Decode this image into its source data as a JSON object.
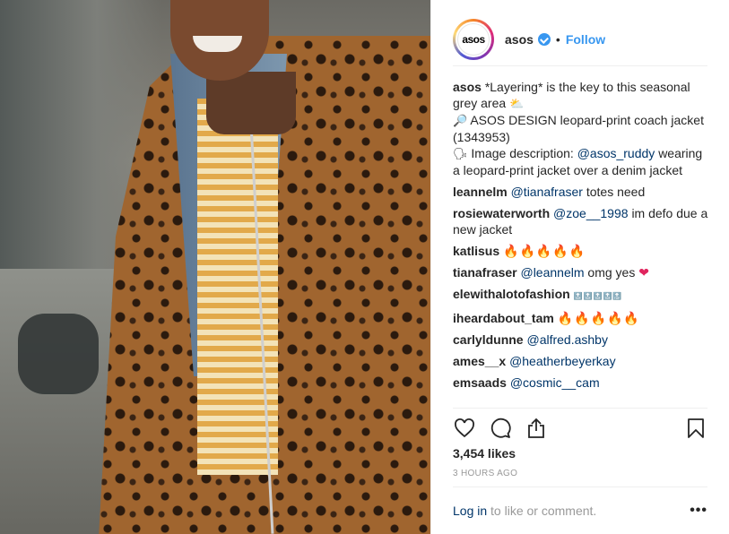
{
  "post": {
    "username": "asos",
    "follow_label": "Follow",
    "dot": "•",
    "avatar_text": "asos"
  },
  "caption": {
    "username": "asos",
    "line1": "*Layering* is the key to this seasonal grey area",
    "line1_emoji": "⛅",
    "line2_emoji": "🔎",
    "line2": "ASOS DESIGN leopard-print coach jacket (1343953)",
    "line3_emoji": "🗣",
    "line3_text": "Image description:",
    "line3_mention": "@asos_ruddy",
    "line3_rest": "wearing a leopard-print jacket over a denim jacket"
  },
  "comments": [
    {
      "user": "leannelm",
      "mention": "@tianafraser",
      "text": "totes need"
    },
    {
      "user": "rosiewaterworth",
      "mention": "@zoe__1998",
      "text": "im defo due a new jacket"
    },
    {
      "user": "katlisus",
      "mention": "",
      "text": "🔥🔥🔥🔥🔥"
    },
    {
      "user": "tianafraser",
      "mention": "@leannelm",
      "text": "omg yes",
      "emoji": "❤"
    },
    {
      "user": "elewithalotofashion",
      "mention": "",
      "text": "🔝🔝🔝🔝🔝"
    },
    {
      "user": "iheardabout_tam",
      "mention": "",
      "text": "🔥🔥🔥🔥🔥"
    },
    {
      "user": "carlyldunne",
      "mention": "@alfred.ashby",
      "text": ""
    },
    {
      "user": "ames__x",
      "mention": "@heatherbeyerkay",
      "text": ""
    },
    {
      "user": "emsaads",
      "mention": "@cosmic__cam",
      "text": ""
    }
  ],
  "stats": {
    "likes": "3,454 likes",
    "time": "3 HOURS AGO"
  },
  "footer": {
    "login": "Log in",
    "rest": "to like or comment.",
    "more": "•••"
  },
  "icons": [
    "heart-icon",
    "comment-icon",
    "share-icon",
    "bookmark-icon",
    "verified-badge-icon"
  ],
  "colors": {
    "link": "#003569",
    "follow": "#3897f0",
    "muted": "#999999"
  }
}
